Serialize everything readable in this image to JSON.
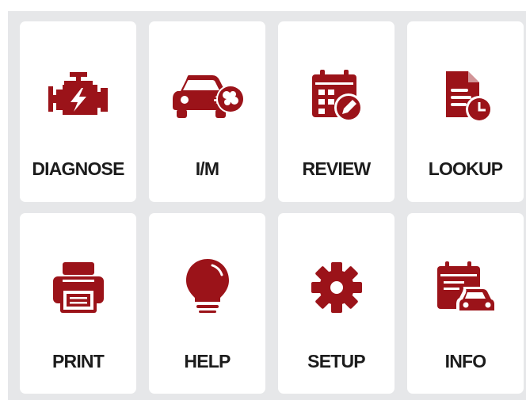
{
  "theme": {
    "accent": "#9b1319",
    "tile_bg": "#ffffff",
    "screen_bg": "#e6e7e9",
    "label_color": "#1c1c1c"
  },
  "menu": {
    "tiles": [
      {
        "label": "DIAGNOSE",
        "icon": "engine-icon"
      },
      {
        "label": "I/M",
        "icon": "car-emission-icon"
      },
      {
        "label": "REVIEW",
        "icon": "calendar-edit-icon"
      },
      {
        "label": "LOOKUP",
        "icon": "document-clock-icon"
      },
      {
        "label": "PRINT",
        "icon": "printer-icon"
      },
      {
        "label": "HELP",
        "icon": "lightbulb-icon"
      },
      {
        "label": "SETUP",
        "icon": "gear-icon"
      },
      {
        "label": "INFO",
        "icon": "calendar-car-icon"
      }
    ]
  }
}
